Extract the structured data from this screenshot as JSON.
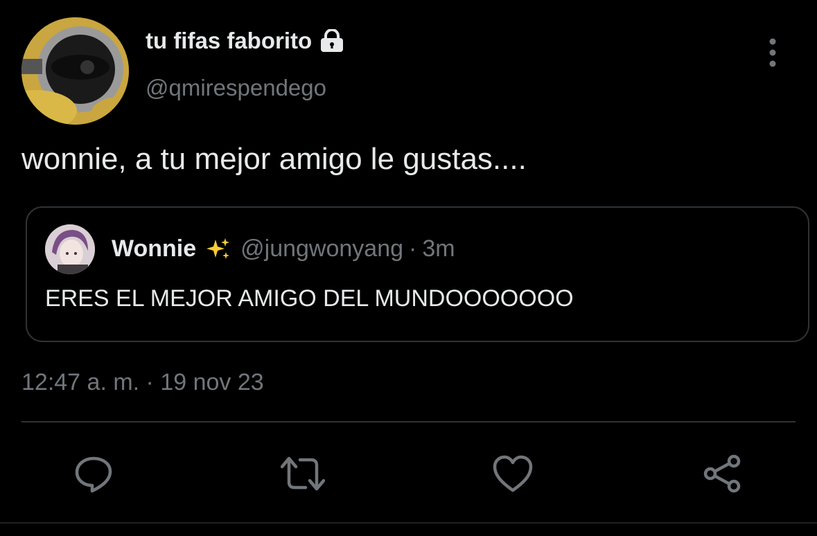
{
  "author": {
    "display_name": "tu fifas faborito",
    "handle": "@qmirespendego",
    "protected_icon": "lock-icon",
    "avatar": "minion-avatar"
  },
  "tweet": {
    "text": "wonnie, a tu mejor amigo le gustas....",
    "timestamp": "12:47 a. m. · 19 nov 23"
  },
  "quoted_tweet": {
    "display_name": "Wonnie",
    "emoji_icon": "sparkles-icon",
    "handle": "@jungwonyang",
    "separator": "·",
    "time": "3m",
    "text": "ERES EL MEJOR AMIGO DEL MUNDOOOOOOO"
  },
  "actions": [
    {
      "icon": "reply-icon"
    },
    {
      "icon": "retweet-icon"
    },
    {
      "icon": "like-icon"
    },
    {
      "icon": "share-icon"
    }
  ],
  "colors": {
    "background": "#000000",
    "primary_text": "#e7e9ea",
    "secondary_text": "#71767b",
    "border": "#2f3336",
    "sparkle": "#ffcc33"
  }
}
